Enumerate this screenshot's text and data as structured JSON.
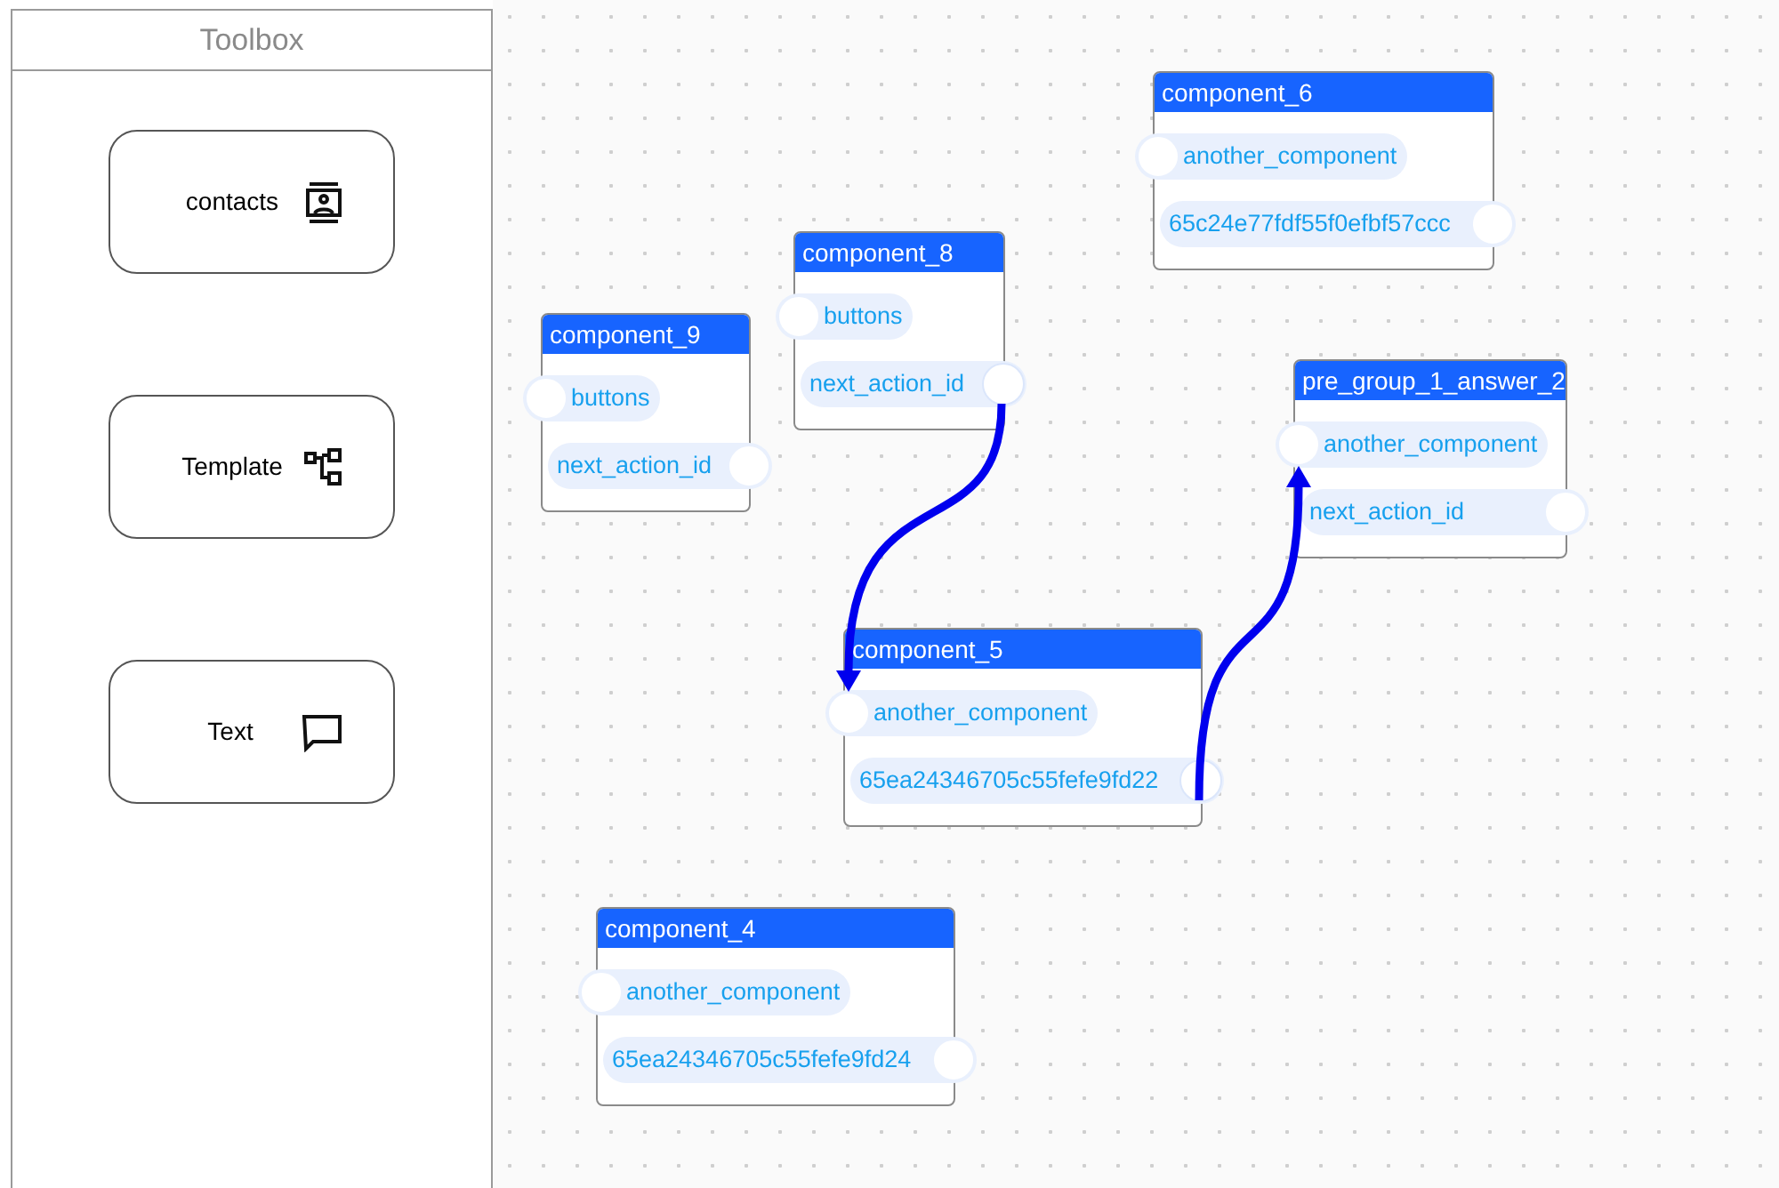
{
  "toolbox": {
    "title": "Toolbox",
    "items": [
      {
        "label": "contacts",
        "kind": "contacts"
      },
      {
        "label": "Template",
        "kind": "template"
      },
      {
        "label": "Text",
        "kind": "text"
      }
    ]
  },
  "canvas": {
    "nodes": [
      {
        "title": "component_6",
        "input": "another_component",
        "output": "65c24e77fdf55f0efbf57ccc",
        "output_linked": false
      },
      {
        "title": "component_8",
        "input": "buttons",
        "output": "next_action_id",
        "output_linked": true
      },
      {
        "title": "component_9",
        "input": "buttons",
        "output": "next_action_id",
        "output_linked": false
      },
      {
        "title": "pre_group_1_answer_2",
        "input": "another_component",
        "output": "next_action_id",
        "output_linked": false
      },
      {
        "title": "component_5",
        "input": "another_component",
        "output": "65ea24346705c55fefe9fd22",
        "output_linked": true
      },
      {
        "title": "component_4",
        "input": "another_component",
        "output": "65ea24346705c55fefe9fd24",
        "output_linked": false
      }
    ]
  }
}
